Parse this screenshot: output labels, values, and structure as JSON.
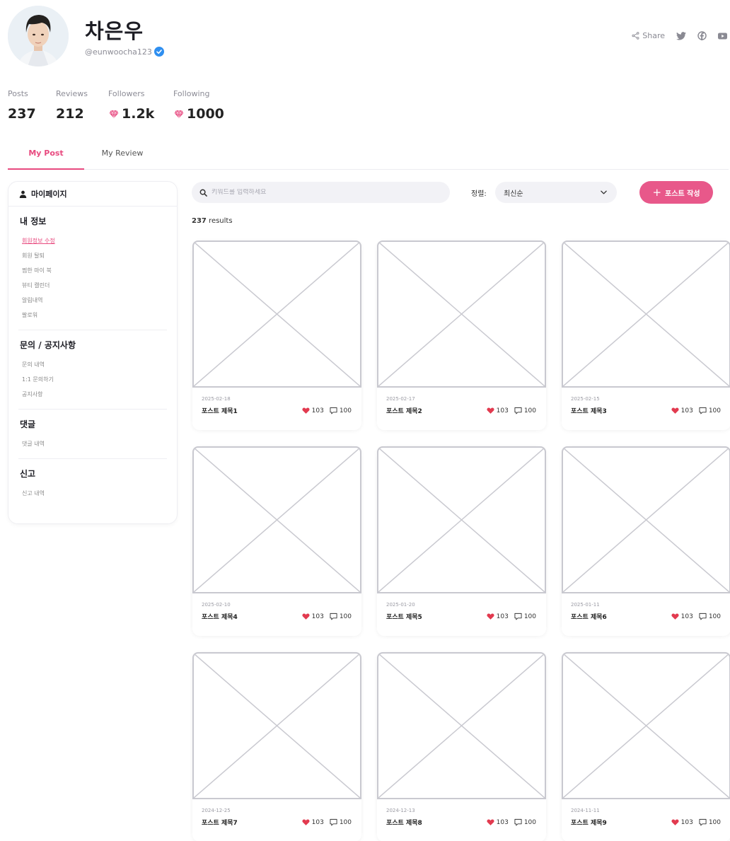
{
  "profile": {
    "name": "차은우",
    "handle": "@eunwoocha123"
  },
  "share": {
    "label": "Share",
    "icons": [
      "share-icon",
      "twitter-icon",
      "facebook-icon",
      "youtube-icon"
    ]
  },
  "stats": [
    {
      "label": "Posts",
      "value": "237"
    },
    {
      "label": "Reviews",
      "value": "212"
    },
    {
      "label": "Followers",
      "value": "1.2k"
    },
    {
      "label": "Following",
      "value": "1000"
    }
  ],
  "tabs": [
    {
      "label": "My Post",
      "active": true
    },
    {
      "label": "My Review",
      "active": false
    }
  ],
  "sidebar": {
    "header": "마이페이지",
    "sections": [
      {
        "title": "내 정보",
        "items": [
          "회원정보 수정",
          "회원 탈퇴",
          "찜한 마이 북",
          "뷰티 캘린더",
          "알림내역",
          "팔로워"
        ]
      },
      {
        "title": "문의 / 공지사항",
        "items": [
          "문의 내역",
          "1:1 문의하기",
          "공지사항"
        ]
      },
      {
        "title": "댓글",
        "items": [
          "댓글 내역"
        ]
      },
      {
        "title": "신고",
        "items": [
          "신고 내역"
        ]
      }
    ]
  },
  "search": {
    "placeholder": "키워드를 입력하세요"
  },
  "sort": {
    "label": "정렬:",
    "selected": "최신순"
  },
  "write_button": {
    "label": "포스트 작성"
  },
  "results": {
    "count": "237",
    "suffix": " results"
  },
  "posts": [
    {
      "date": "2025-02-18",
      "title": "포스트 제목1",
      "likes": "103",
      "comments": "100"
    },
    {
      "date": "2025-02-17",
      "title": "포스트 제목2",
      "likes": "103",
      "comments": "100"
    },
    {
      "date": "2025-02-15",
      "title": "포스트 제목3",
      "likes": "103",
      "comments": "100"
    },
    {
      "date": "2025-02-10",
      "title": "포스트 제목4",
      "likes": "103",
      "comments": "100"
    },
    {
      "date": "2025-01-20",
      "title": "포스트 제목5",
      "likes": "103",
      "comments": "100"
    },
    {
      "date": "2025-01-11",
      "title": "포스트 제목6",
      "likes": "103",
      "comments": "100"
    },
    {
      "date": "2024-12-25",
      "title": "포스트 제목7",
      "likes": "103",
      "comments": "100"
    },
    {
      "date": "2024-12-13",
      "title": "포스트 제목8",
      "likes": "103",
      "comments": "100"
    },
    {
      "date": "2024-11-11",
      "title": "포스트 제목9",
      "likes": "103",
      "comments": "100"
    }
  ],
  "colors": {
    "accent": "#e84a7f",
    "button": "#e8588a",
    "heart": "#e23a4f",
    "verified": "#2f8ff0"
  }
}
